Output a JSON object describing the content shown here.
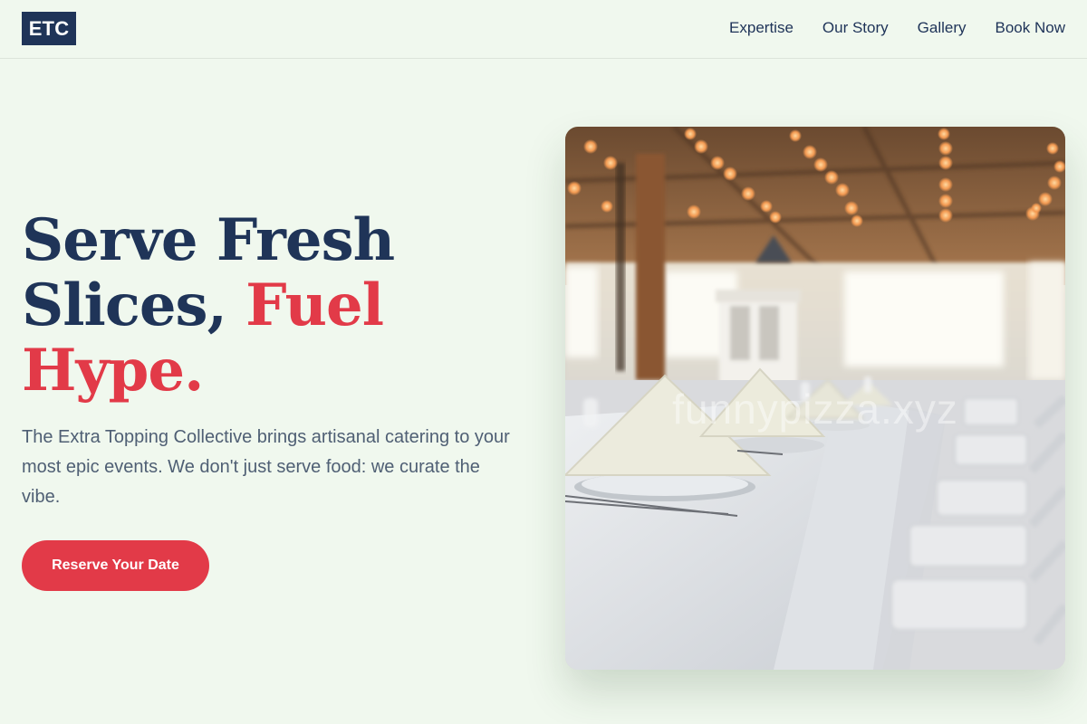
{
  "header": {
    "logo": "ETC",
    "nav": [
      "Expertise",
      "Our Story",
      "Gallery",
      "Book Now"
    ]
  },
  "hero": {
    "title_line1": "Serve Fresh",
    "title_line2a": "Slices, ",
    "title_line2b": "Fuel",
    "title_line3": "Hype.",
    "description": "The Extra Topping Collective brings artisanal catering to your most epic events. We don't just serve food: we curate the vibe.",
    "cta": "Reserve Your Date"
  },
  "image": {
    "subject": "banquet-table-photo",
    "watermark": "funnypizza.xyz"
  },
  "colors": {
    "background": "#f0f8ee",
    "navy": "#1f3458",
    "accent": "#e23a48",
    "body_text": "#4f5f74"
  }
}
